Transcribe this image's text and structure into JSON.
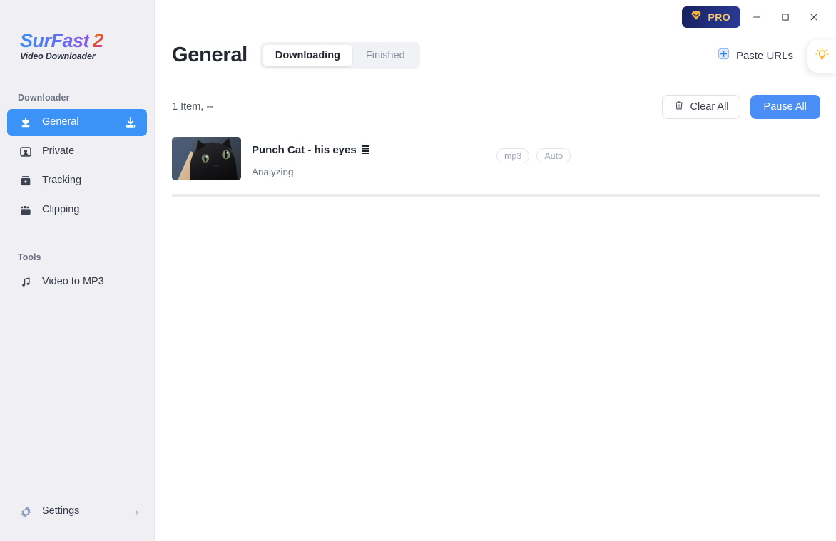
{
  "app": {
    "logo_main": "SurFast",
    "logo_two": "2",
    "logo_sub": "Video Downloader"
  },
  "titlebar": {
    "pro_label": "PRO",
    "pro_icon": "diamond-crown-icon",
    "minimize_icon": "minimize-icon",
    "maximize_icon": "maximize-icon",
    "close_icon": "close-icon"
  },
  "sidebar": {
    "downloader_label": "Downloader",
    "tools_label": "Tools",
    "items": [
      {
        "label": "General",
        "icon": "download-arrow-icon",
        "active": true,
        "trailing_icon": "download-tray-icon"
      },
      {
        "label": "Private",
        "icon": "private-user-icon",
        "active": false
      },
      {
        "label": "Tracking",
        "icon": "tracking-camera-icon",
        "active": false
      },
      {
        "label": "Clipping",
        "icon": "clipping-film-icon",
        "active": false
      }
    ],
    "tools": [
      {
        "label": "Video to MP3",
        "icon": "music-note-icon"
      }
    ],
    "settings": {
      "label": "Settings",
      "icon": "gear-icon",
      "chevron": "chevron-right-icon"
    }
  },
  "header": {
    "title": "General",
    "tabs": [
      {
        "label": "Downloading",
        "active": true
      },
      {
        "label": "Finished",
        "active": false
      }
    ],
    "paste_urls_label": "Paste URLs",
    "paste_urls_icon": "plus-square-icon",
    "bulb_icon": "lightbulb-icon"
  },
  "subbar": {
    "item_count": "1 Item, --",
    "clear_all_label": "Clear All",
    "clear_all_icon": "trash-icon",
    "pause_all_label": "Pause All"
  },
  "downloads": [
    {
      "title": "Punch Cat - his eyes",
      "title_glyph": "tofu-block-glyph",
      "status": "Analyzing",
      "tags": [
        "mp3",
        "Auto"
      ],
      "progress_percent": 0,
      "thumbnail": "black-cat-thumbnail"
    }
  ],
  "colors": {
    "accent_blue": "#4a8ef6",
    "sidebar_bg": "#f0f0f4",
    "pro_navy": "#223080",
    "pro_gold": "#f5c971",
    "bulb_yellow": "#f5b321",
    "text_primary": "#23272f",
    "text_muted": "#6d7280"
  }
}
